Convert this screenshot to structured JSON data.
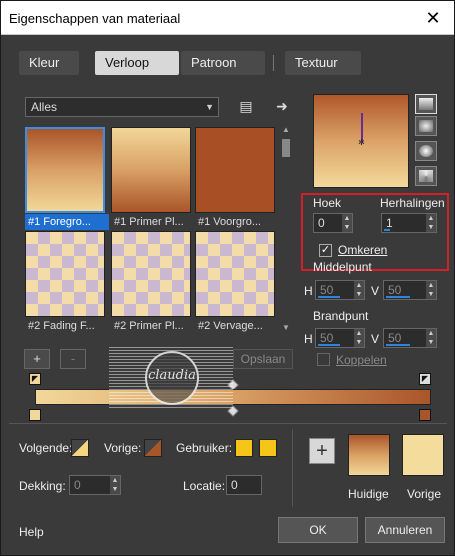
{
  "window": {
    "title": "Eigenschappen van materiaal",
    "close_glyph": "✕"
  },
  "tabs": [
    {
      "label": "Kleur"
    },
    {
      "label": "Verloop"
    },
    {
      "label": "Patroon"
    },
    {
      "label": "Textuur"
    }
  ],
  "active_tab": "Verloop",
  "presets": {
    "category": "Alles",
    "items": [
      {
        "label": "#1 Foregro..."
      },
      {
        "label": "#1 Primer Pl..."
      },
      {
        "label": "#1 Voorgro..."
      },
      {
        "label": "#2 Fading F..."
      },
      {
        "label": "#2 Primer Pl..."
      },
      {
        "label": "#2 Vervage..."
      }
    ]
  },
  "params": {
    "hoek_label": "Hoek",
    "hoek_value": "0",
    "herhalingen_label": "Herhalingen",
    "herhalingen_value": "1",
    "omkeren_label": "Omkeren",
    "omkeren_checked": true,
    "middelpunt_label": "Middelpunt",
    "middelpunt_h_label": "H",
    "middelpunt_h": "50",
    "middelpunt_v_label": "V",
    "middelpunt_v": "50",
    "brandpunt_label": "Brandpunt",
    "brandpunt_h_label": "H",
    "brandpunt_h": "50",
    "brandpunt_v_label": "V",
    "brandpunt_v": "50",
    "koppelen_label": "Koppelen"
  },
  "editor": {
    "add_label": "+",
    "remove_label": "-",
    "save_label": "Opslaan",
    "watermark_text": "claudia",
    "colors": {
      "start": "#f2d79a",
      "mid": "#d9a064",
      "end": "#a9552a"
    }
  },
  "bottom_panel": {
    "volgende_label": "Volgende:",
    "vorige_label": "Vorige:",
    "gebruiker_label": "Gebruiker:",
    "dekking_label": "Dekking:",
    "dekking_value": "0",
    "locatie_label": "Locatie:",
    "locatie_value": "0",
    "huidige_label": "Huidige",
    "vorige_swatch_label": "Vorige",
    "user_color": "#f5c518",
    "prev_color": "#a9552a"
  },
  "buttons": {
    "help": "Help",
    "ok": "OK",
    "cancel": "Annuleren"
  }
}
